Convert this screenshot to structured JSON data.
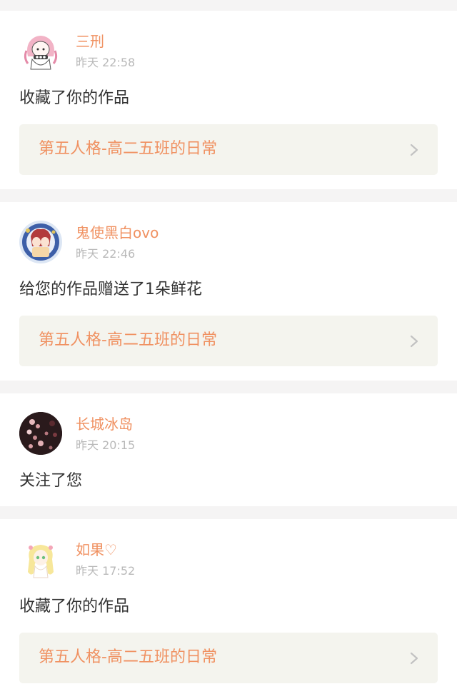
{
  "notifications": [
    {
      "user_name": "三刑",
      "time": "昨天 22:58",
      "action": "收藏了你的作品",
      "work_title": "第五人格-高二五班的日常",
      "avatar_icon": "anime-girl-pink-hair-avatar"
    },
    {
      "user_name": "鬼使黑白ovo",
      "time": "昨天 22:46",
      "action": "给您的作品赠送了1朵鲜花",
      "work_title": "第五人格-高二五班的日常",
      "avatar_icon": "anime-characters-blue-avatar"
    },
    {
      "user_name": "长城冰岛",
      "time": "昨天 20:15",
      "action": "关注了您",
      "avatar_icon": "dark-blossom-photo-avatar"
    },
    {
      "user_name": "如果♡",
      "time": "昨天 17:52",
      "action": "收藏了你的作品",
      "work_title": "第五人格-高二五班的日常",
      "avatar_icon": "anime-girl-blonde-avatar"
    }
  ],
  "colors": {
    "accent": "#f09161",
    "timestamp": "#b9b9b9",
    "body_text": "#333333",
    "link_bg": "#f4f4ee",
    "page_bg": "#f5f4f4"
  }
}
